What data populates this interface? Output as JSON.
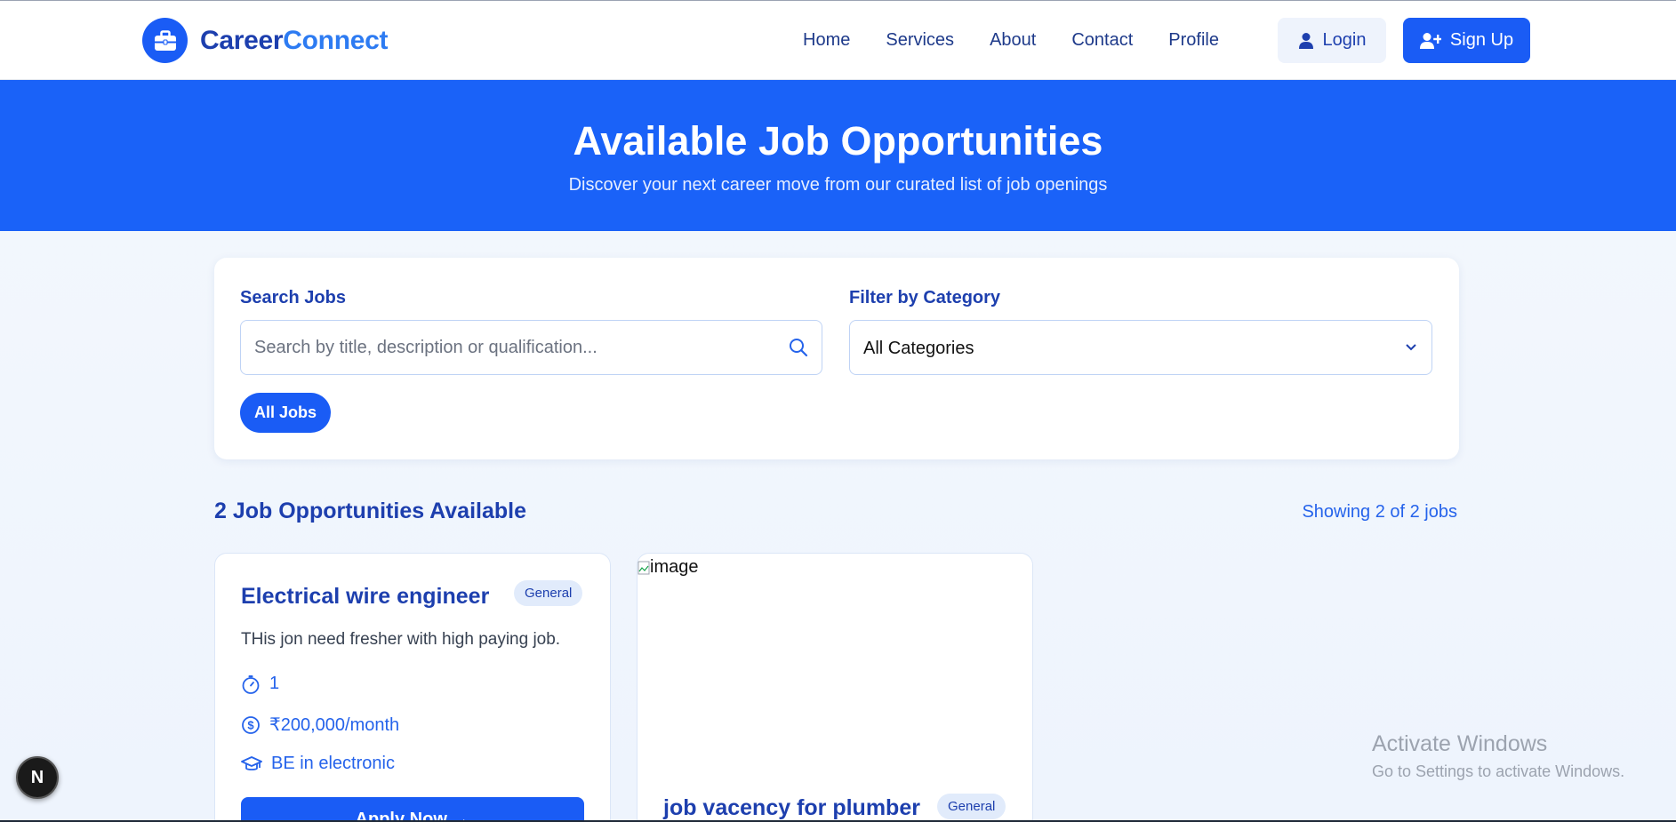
{
  "brand": {
    "name_part1": "Career",
    "name_part2": "Connect",
    "logo_icon": "briefcase-icon"
  },
  "nav": {
    "links": [
      "Home",
      "Services",
      "About",
      "Contact",
      "Profile"
    ],
    "login_label": "Login",
    "signup_label": "Sign Up"
  },
  "hero": {
    "title": "Available Job Opportunities",
    "subtitle": "Discover your next career move from our curated list of job openings"
  },
  "filters": {
    "search_label": "Search Jobs",
    "search_placeholder": "Search by title, description or qualification...",
    "search_value": "",
    "category_label": "Filter by Category",
    "category_selected": "All Categories",
    "chips": [
      "All Jobs"
    ]
  },
  "results": {
    "count_text": "2 Job Opportunities Available",
    "showing_text": "Showing 2 of 2 jobs"
  },
  "jobs": [
    {
      "title": "Electrical wire engineer",
      "category": "General",
      "description": "THis jon need fresher with high paying job.",
      "experience": "1",
      "salary": "₹200,000/month",
      "qualification": "BE in electronic",
      "apply_label": "Apply Now →"
    },
    {
      "image_alt": "image",
      "title": "job vacency for plumber",
      "category": "General"
    }
  ],
  "overlays": {
    "watermark_title": "Activate Windows",
    "watermark_sub": "Go to Settings to activate Windows.",
    "dev_badge": "N"
  },
  "colors": {
    "primary": "#1a5cf5",
    "hero": "#1a62f8",
    "text_dark": "#1d3fae",
    "accent": "#2d7bf2"
  }
}
